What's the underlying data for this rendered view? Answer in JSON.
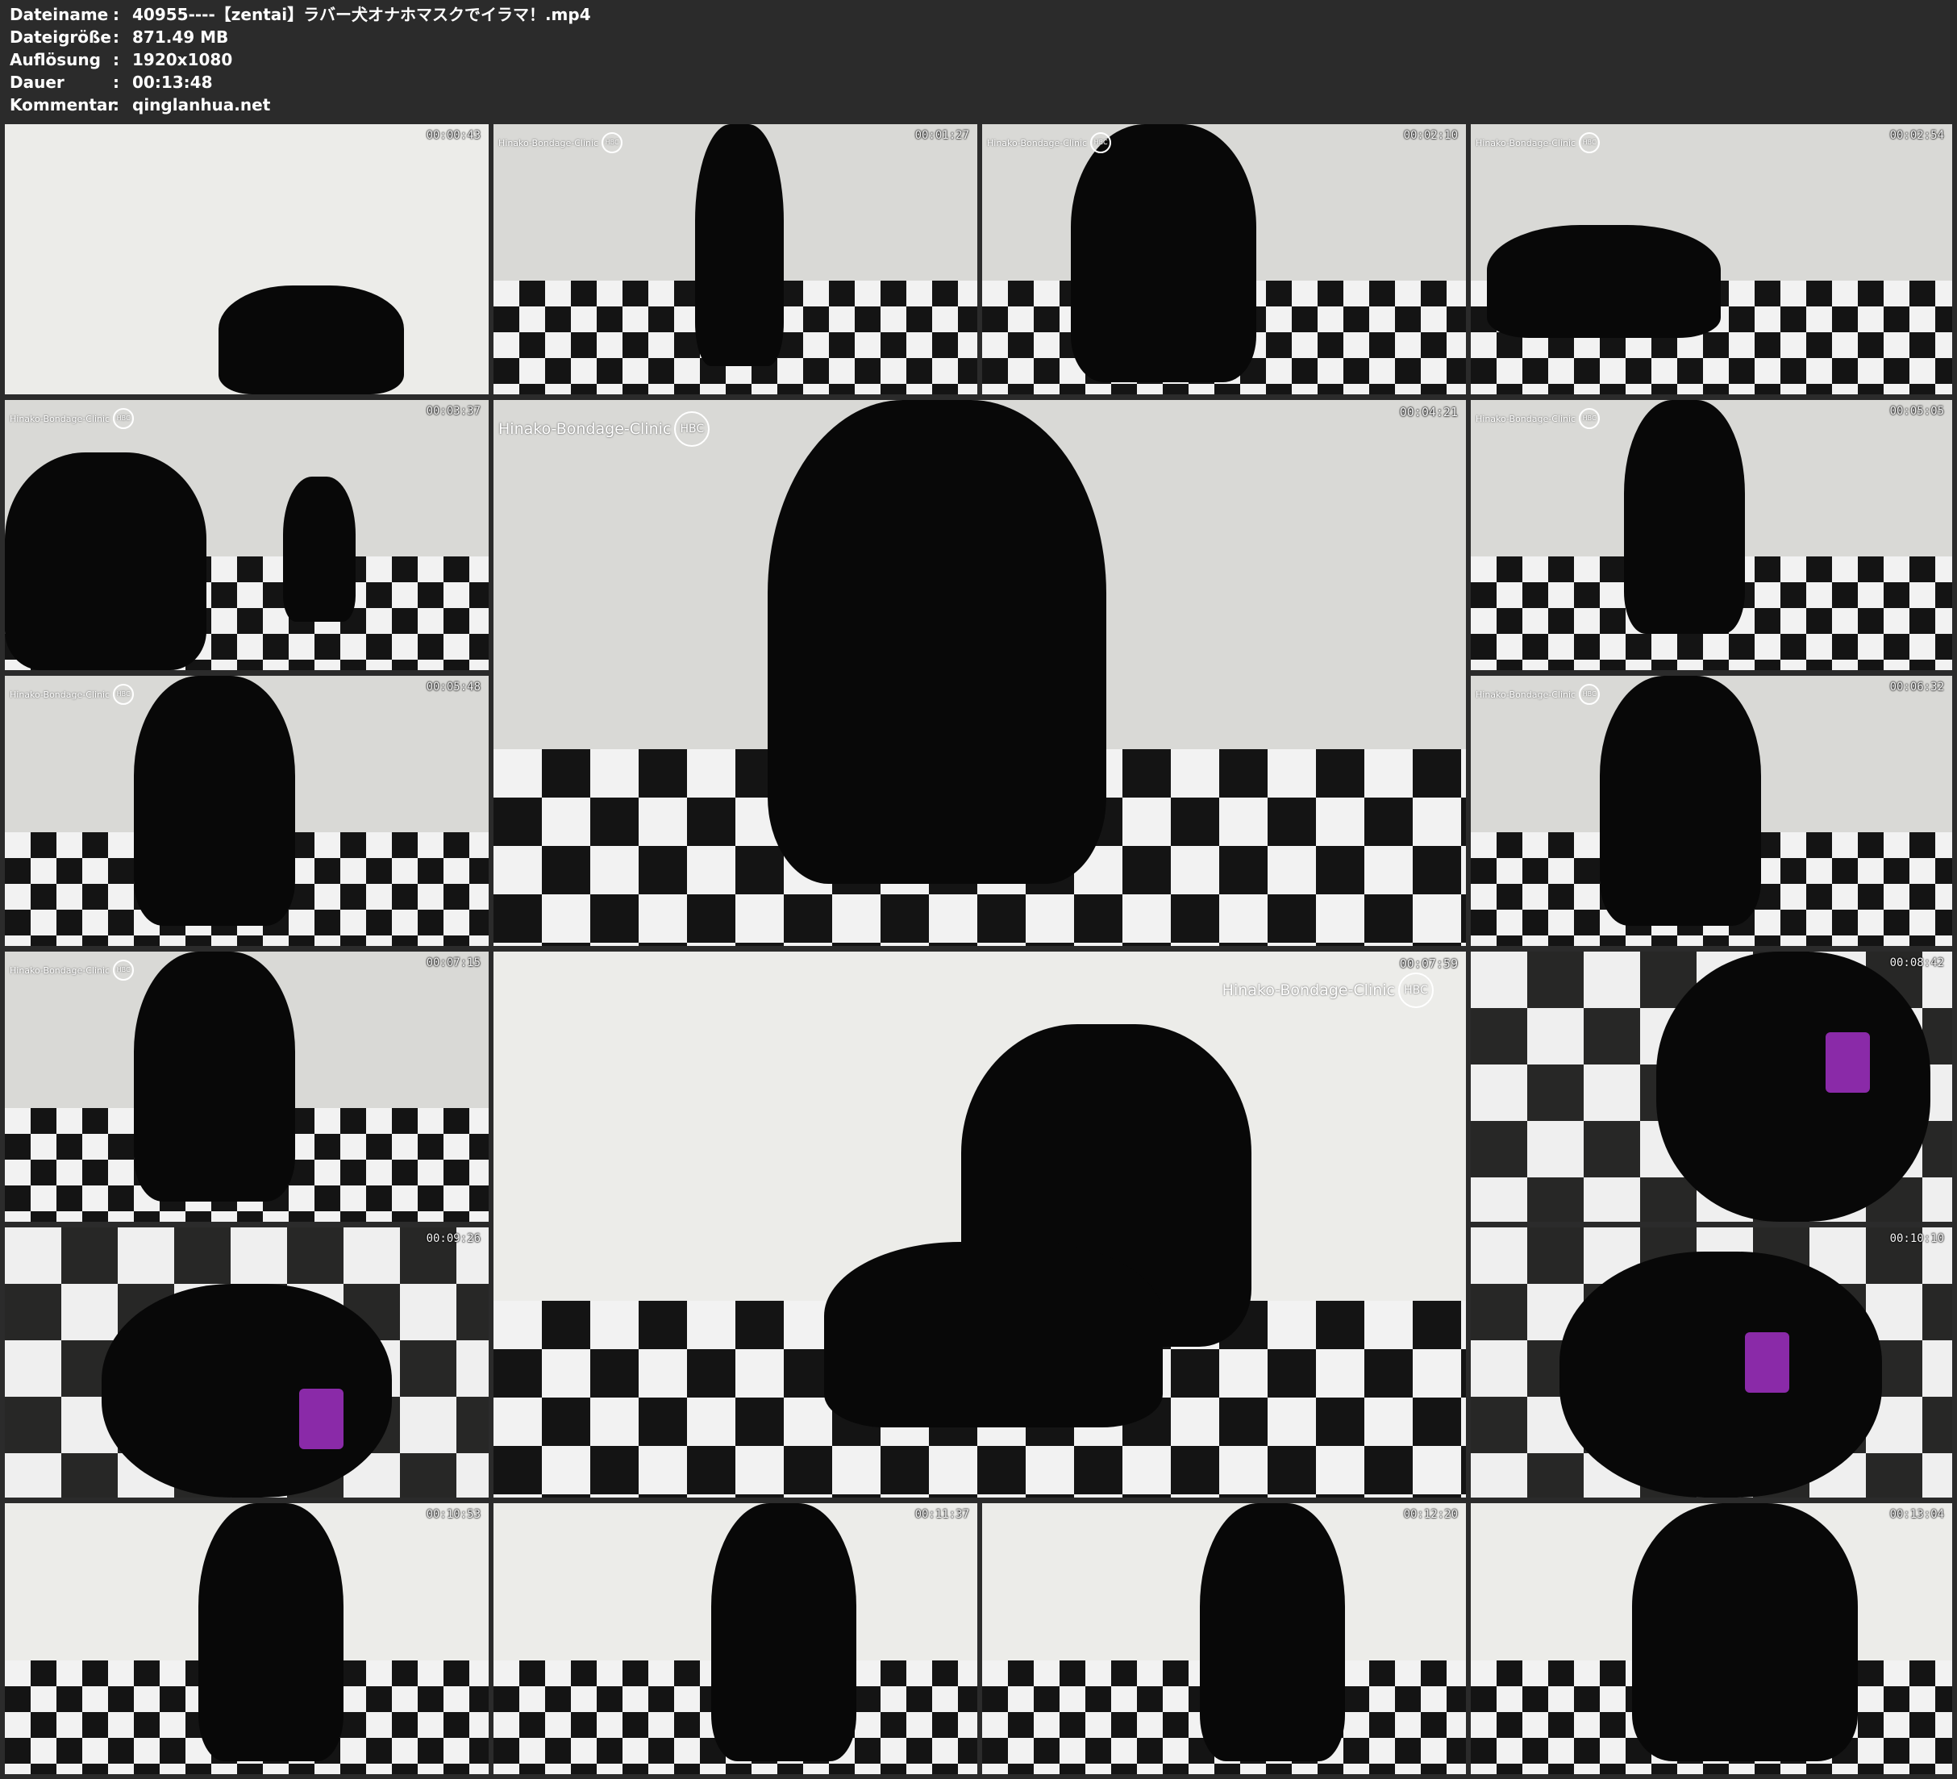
{
  "file_info": [
    {
      "label": "Dateiname",
      "value": "40955----【zentai】ラバー犬オナホマスクでイラマ！.mp4"
    },
    {
      "label": "Dateigröße",
      "value": "871.49 MB"
    },
    {
      "label": "Auflösung",
      "value": "1920x1080"
    },
    {
      "label": "Dauer",
      "value": "00:13:48"
    },
    {
      "label": "Kommentar",
      "value": "qinglanhua.net"
    }
  ],
  "separator": ":",
  "watermark": {
    "text": "Hinako-Bondage-Clinic",
    "logo": "HBC"
  },
  "thumbnails": [
    {
      "timestamp": "00:00:43"
    },
    {
      "timestamp": "00:01:27"
    },
    {
      "timestamp": "00:02:10"
    },
    {
      "timestamp": "00:02:54"
    },
    {
      "timestamp": "00:03:37"
    },
    {
      "timestamp": "00:04:21"
    },
    {
      "timestamp": "00:05:05"
    },
    {
      "timestamp": "00:05:48"
    },
    {
      "timestamp": "00:06:32"
    },
    {
      "timestamp": "00:07:15"
    },
    {
      "timestamp": "00:07:59"
    },
    {
      "timestamp": "00:08:42"
    },
    {
      "timestamp": "00:09:26"
    },
    {
      "timestamp": "00:10:10"
    },
    {
      "timestamp": "00:10:53"
    },
    {
      "timestamp": "00:11:37"
    },
    {
      "timestamp": "00:12:20"
    },
    {
      "timestamp": "00:13:04"
    }
  ],
  "colors": {
    "background": "#2b2b2b",
    "latex": "#080808",
    "accent": "#8a2aa8",
    "floor_dark": "#141414",
    "floor_light": "#f2f2f2"
  }
}
